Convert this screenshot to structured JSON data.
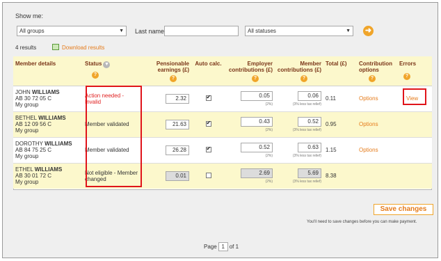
{
  "filters": {
    "show_me_label": "Show me:",
    "group_select": "All groups",
    "last_name_label": "Last name",
    "last_name_value": "",
    "status_select": "All statuses"
  },
  "results": {
    "count_text": "4 results",
    "download_label": "Download results"
  },
  "table": {
    "headers": {
      "member": "Member details",
      "status": "Status",
      "pensionable": "Pensionable earnings (£)",
      "auto": "Auto calc.",
      "employer": "Employer contributions (£)",
      "member_contrib": "Member contributions (£)",
      "total": "Total (£)",
      "options": "Contribution options",
      "errors": "Errors"
    },
    "rows": [
      {
        "first": "JOHN",
        "last": "WILLIAMS",
        "ni": "AB 30 72 05 C",
        "group": "My group",
        "status": "Action needed - Invalid",
        "earnings": "2.32",
        "employer": "0.05",
        "employer_note": "(2%)",
        "member": "0.06",
        "member_note": "(3% less tax relief)",
        "total": "0.11",
        "options": "Options",
        "error_link": "View"
      },
      {
        "first": "BETHEL",
        "last": "WILLIAMS",
        "ni": "AB 12 09 56 C",
        "group": "My group",
        "status": "Member validated",
        "earnings": "21.63",
        "employer": "0.43",
        "employer_note": "(2%)",
        "member": "0.52",
        "member_note": "(3% less tax relief)",
        "total": "0.95",
        "options": "Options",
        "error_link": ""
      },
      {
        "first": "DOROTHY",
        "last": "WILLIAMS",
        "ni": "AB 84 75 25 C",
        "group": "My group",
        "status": "Member validated",
        "earnings": "26.28",
        "employer": "0.52",
        "employer_note": "(2%)",
        "member": "0.63",
        "member_note": "(3% less tax relief)",
        "total": "1.15",
        "options": "Options",
        "error_link": ""
      },
      {
        "first": "ETHEL",
        "last": "WILLIAMS",
        "ni": "AB 30 01 72 C",
        "group": "My group",
        "status": "Not eligible - Member changed",
        "earnings": "0.01",
        "employer": "2.69",
        "employer_note": "(2%)",
        "member": "5.69",
        "member_note": "(3% less tax relief)",
        "total": "8.38",
        "options": "",
        "error_link": ""
      }
    ]
  },
  "save": {
    "button_label": "Save changes",
    "note": "You'll need to save changes before you can make payment."
  },
  "pager": {
    "page_label": "Page",
    "current": "1",
    "of_label": "of 1"
  },
  "colors": {
    "accent": "#e57c1c",
    "header_bg": "#fcf8cc",
    "error_red": "#e0141a"
  }
}
